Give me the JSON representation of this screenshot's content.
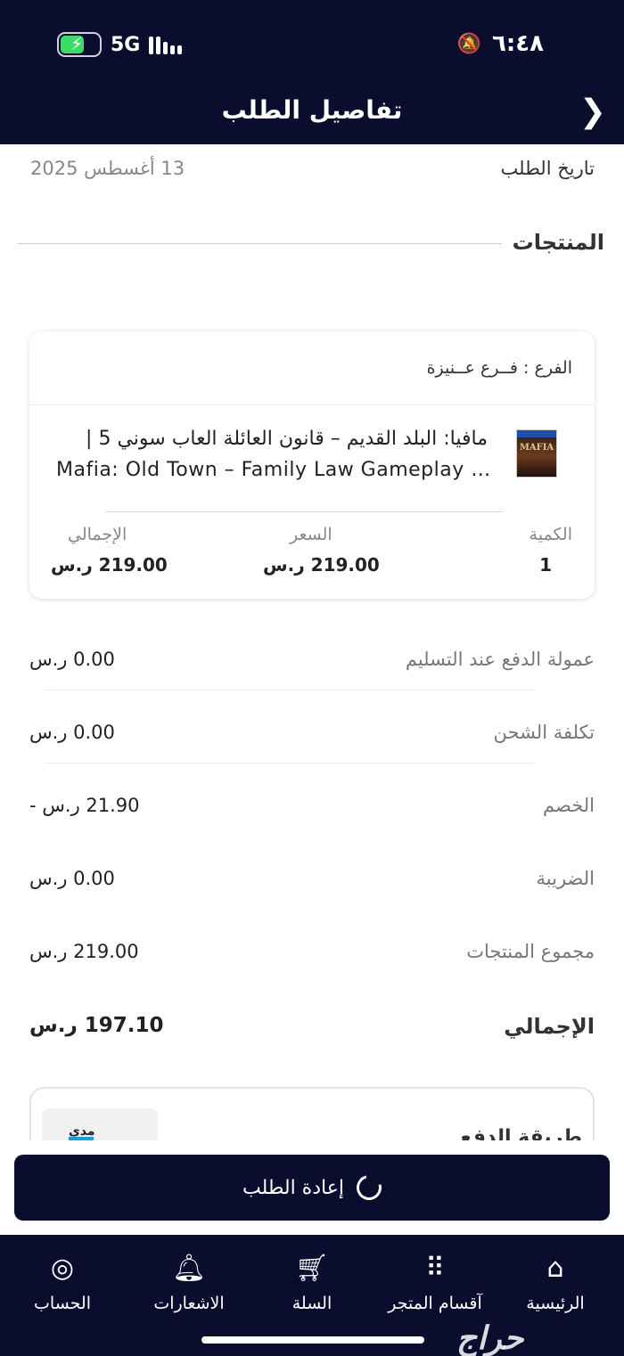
{
  "status_bar": {
    "time": "٦:٤٨",
    "network": "5G",
    "bell_icon": "bell-slash-icon",
    "battery_icon": "battery-charging-icon"
  },
  "header": {
    "title": "تفاصيل الطلب",
    "back_icon": "chevron-right-icon"
  },
  "order": {
    "date_label": "تاريخ الطلب",
    "date_value": "13 أغسطس 2025"
  },
  "products_section": {
    "title": "المنتجات",
    "branch": "الفرع : فــرع عــنيزة",
    "item": {
      "title_ar": "مافيا: البلد القديم – قانون العائلة العاب سوني 5 |",
      "title_en": "Mafia: Old Town – Family Law Gameplay i...",
      "image_logo": "MAFIA",
      "quantity_label": "الكمية",
      "quantity_value": "1",
      "price_label": "السعر",
      "price_value": "219.00 ر.س",
      "total_label": "الإجمالي",
      "total_value": "219.00 ر.س"
    }
  },
  "summary": {
    "cod_fee_label": "عمولة الدفع عند التسليم",
    "cod_fee_value": "0.00 ر.س",
    "shipping_label": "تكلفة الشحن",
    "shipping_value": "0.00 ر.س",
    "discount_label": "الخصم",
    "discount_value": "21.90 ر.س -",
    "tax_label": "الضريبة",
    "tax_value": "0.00 ر.س",
    "subtotal_label": "مجموع المنتجات",
    "subtotal_value": "219.00 ر.س",
    "total_label": "الإجمالي",
    "total_value": "197.10 ر.س"
  },
  "payment": {
    "label": "طريقة الدفع",
    "method": "مدى"
  },
  "reorder_button": {
    "label": "إعادة الطلب",
    "icon": "refresh-icon"
  },
  "bottom_nav": {
    "items": [
      {
        "label": "الرئيسية",
        "icon": "store-icon"
      },
      {
        "label": "آقسام المتجر",
        "icon": "grid-icon"
      },
      {
        "label": "السلة",
        "icon": "cart-icon"
      },
      {
        "label": "الاشعارات",
        "icon": "bell-icon"
      },
      {
        "label": "الحساب",
        "icon": "user-icon"
      }
    ]
  },
  "watermark": "حراج",
  "colors": {
    "brand_dark": "#0b0d2e",
    "text_muted": "#888888",
    "mada_blue": "#18a0d8"
  }
}
